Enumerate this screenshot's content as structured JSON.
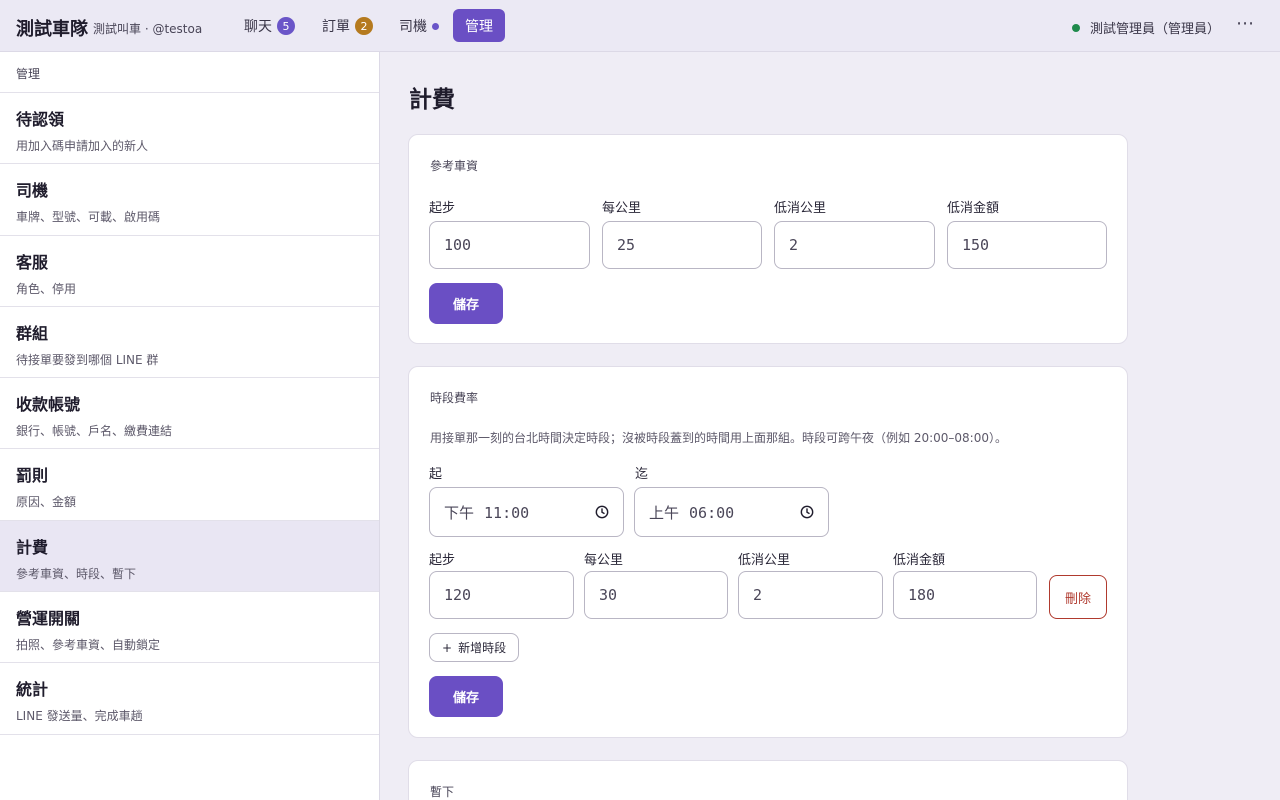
{
  "header": {
    "brand": "測試車隊",
    "brand_sub": "測試叫車 · @testoa",
    "tabs": [
      {
        "label": "聊天",
        "badge": "5",
        "badge_color": "#6a55c8"
      },
      {
        "label": "訂單",
        "badge": "2",
        "badge_color": "#b57a1e"
      },
      {
        "label": "司機",
        "dot_color": "#6a55c8"
      },
      {
        "label": "管理"
      }
    ],
    "user_status": "測試管理員（管理員）",
    "online_color": "#1f8a4c",
    "more": "⋯"
  },
  "sidebar": {
    "heading": "管理",
    "items": [
      {
        "title": "待認領",
        "desc": "用加入碼申請加入的新人"
      },
      {
        "title": "司機",
        "desc": "車牌、型號、可載、啟用碼"
      },
      {
        "title": "客服",
        "desc": "角色、停用"
      },
      {
        "title": "群組",
        "desc": "待接單要發到哪個 LINE 群"
      },
      {
        "title": "收款帳號",
        "desc": "銀行、帳號、戶名、繳費連結"
      },
      {
        "title": "罰則",
        "desc": "原因、金額"
      },
      {
        "title": "計費",
        "desc": "參考車資、時段、暫下"
      },
      {
        "title": "營運開關",
        "desc": "拍照、參考車資、自動鎖定"
      },
      {
        "title": "統計",
        "desc": "LINE 發送量、完成車趟"
      }
    ]
  },
  "main": {
    "title": "計費",
    "fare": {
      "title": "參考車資",
      "labels": [
        "起步",
        "每公里",
        "低消公里",
        "低消金額"
      ],
      "values": [
        "100",
        "25",
        "2",
        "150"
      ],
      "save": "儲存"
    },
    "period": {
      "title": "時段費率",
      "desc": "用接單那一刻的台北時間決定時段；沒被時段蓋到的時間用上面那組。時段可跨午夜（例如 20:00–08:00）。",
      "from_label": "起",
      "to_label": "迄",
      "from_ampm": "下午",
      "from_time": "11:00",
      "to_ampm": "上午",
      "to_time": "06:00",
      "labels": [
        "起步",
        "每公里",
        "低消公里",
        "低消金額"
      ],
      "values": [
        "120",
        "30",
        "2",
        "180"
      ],
      "delete": "刪除",
      "add": "新增時段",
      "save": "儲存"
    },
    "pause": {
      "title": "暫下"
    }
  }
}
